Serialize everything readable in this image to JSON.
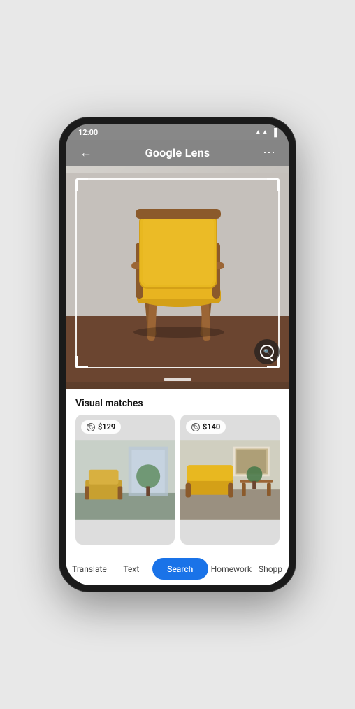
{
  "phone": {
    "status_bar": {
      "time": "12:00",
      "wifi": "▲",
      "signal": "▲",
      "battery": "▮"
    },
    "top_bar": {
      "back_label": "←",
      "title_prefix": "Google ",
      "title_bold": "Lens",
      "more_label": "⋯"
    },
    "camera": {
      "alt_text": "Yellow mid-century modern armchair with wooden frame against white wall on dark wood floor"
    },
    "results": {
      "section_title": "Visual matches",
      "matches": [
        {
          "price": "$129",
          "alt": "Similar yellow chair in room"
        },
        {
          "price": "$140",
          "alt": "Similar yellow chair with wooden side table"
        }
      ]
    },
    "tabs": [
      {
        "id": "translate",
        "label": "Translate",
        "active": false
      },
      {
        "id": "text",
        "label": "Text",
        "active": false
      },
      {
        "id": "search",
        "label": "Search",
        "active": true
      },
      {
        "id": "homework",
        "label": "Homework",
        "active": false
      },
      {
        "id": "shopping",
        "label": "Shopp",
        "active": false
      }
    ],
    "colors": {
      "active_tab_bg": "#1a73e8",
      "active_tab_text": "#ffffff",
      "inactive_tab_text": "#444444"
    }
  }
}
